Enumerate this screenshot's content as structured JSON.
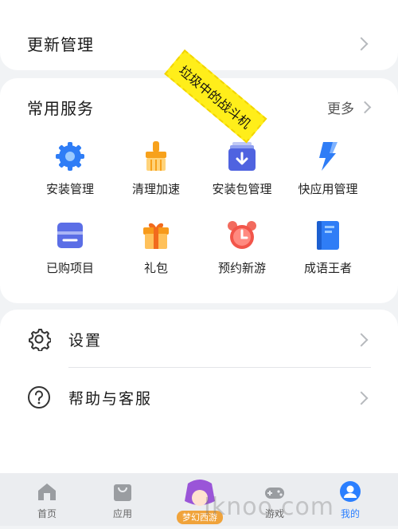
{
  "top": {
    "update_label": "更新管理"
  },
  "services": {
    "title": "常用服务",
    "more": "更多",
    "items": [
      {
        "label": "安装管理",
        "icon": "install-gear-icon"
      },
      {
        "label": "清理加速",
        "icon": "broom-icon"
      },
      {
        "label": "安装包管理",
        "icon": "package-icon"
      },
      {
        "label": "快应用管理",
        "icon": "lightning-icon"
      },
      {
        "label": "已购项目",
        "icon": "purchased-icon"
      },
      {
        "label": "礼包",
        "icon": "gift-icon"
      },
      {
        "label": "预约新游",
        "icon": "alarm-clock-icon"
      },
      {
        "label": "成语王者",
        "icon": "book-icon"
      }
    ]
  },
  "settings": {
    "items": [
      {
        "label": "设置",
        "icon": "gear-icon"
      },
      {
        "label": "帮助与客服",
        "icon": "question-icon"
      }
    ]
  },
  "tabbar": {
    "items": [
      {
        "label": "首页",
        "icon": "home-icon"
      },
      {
        "label": "应用",
        "icon": "shopping-bag-icon"
      },
      {
        "label": "游戏",
        "icon": "gamepad-icon"
      },
      {
        "label": "我的",
        "icon": "user-icon",
        "active": true
      }
    ]
  },
  "overlay": {
    "banner": "垃圾中的战斗机",
    "watermark": "Iknoo.com",
    "mascot_text": "梦幻西游"
  },
  "colors": {
    "accent": "#2b7fff",
    "banner": "#ffee1a"
  }
}
